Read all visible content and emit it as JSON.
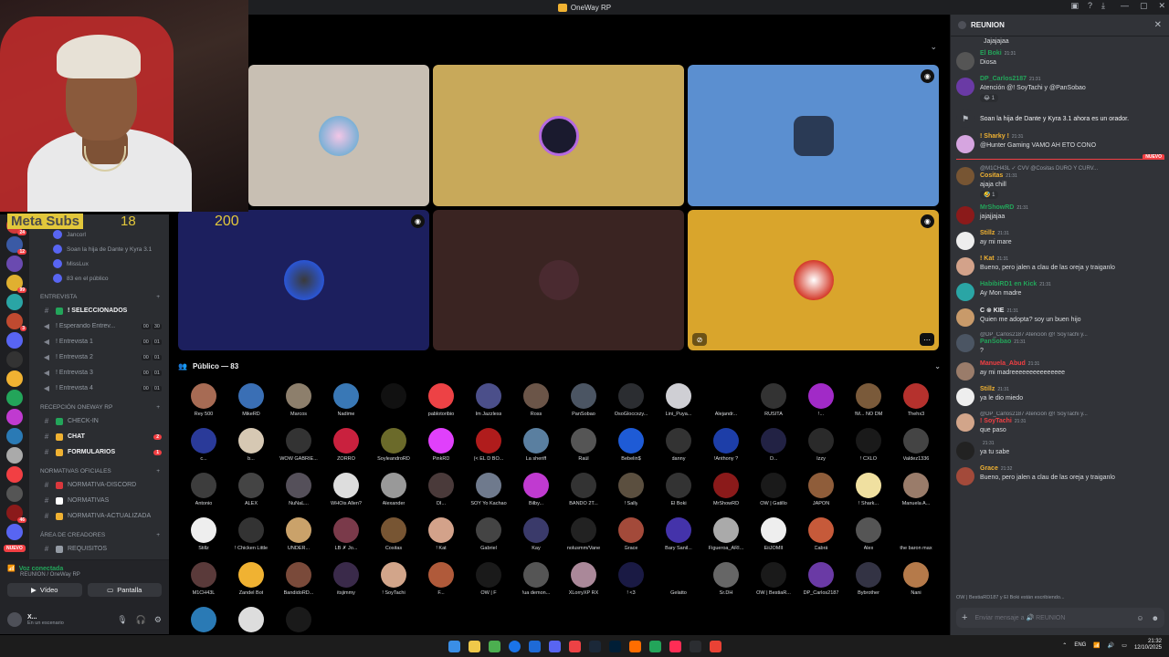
{
  "window": {
    "title": "OneWay RP"
  },
  "overlay": {
    "meta_label": "Meta Subs",
    "subs_count": "18",
    "goal": "200"
  },
  "voice_users": [
    {
      "name": "Jancorl"
    },
    {
      "name": "Soan la hija de Dante y Kyra 3.1"
    },
    {
      "name": "MissLux"
    },
    {
      "name": "83 en el público"
    }
  ],
  "sections": [
    {
      "type": "cat",
      "label": "ENTREVISTA"
    },
    {
      "type": "chan",
      "sym": "#",
      "label": "! SELECCIONADOS",
      "bold": true,
      "box": "#23a55a"
    },
    {
      "type": "chan",
      "sym": "🔊",
      "label": "! Esperando Entrev...",
      "counts": [
        "00",
        "30"
      ]
    },
    {
      "type": "chan",
      "sym": "🔊",
      "label": "! Entrevista 1",
      "counts": [
        "00",
        "01"
      ]
    },
    {
      "type": "chan",
      "sym": "🔊",
      "label": "! Entrevista 2",
      "counts": [
        "00",
        "01"
      ]
    },
    {
      "type": "chan",
      "sym": "🔊",
      "label": "! Entrevista 3",
      "counts": [
        "00",
        "01"
      ]
    },
    {
      "type": "chan",
      "sym": "🔊",
      "label": "! Entrevista 4",
      "counts": [
        "00",
        "01"
      ]
    },
    {
      "type": "cat",
      "label": "Recepción OneWay RP"
    },
    {
      "type": "chan",
      "sym": "#",
      "label": "CHECK-IN",
      "box": "#23a55a"
    },
    {
      "type": "chan",
      "sym": "#",
      "label": "CHAT",
      "bold": true,
      "box": "#f0b232",
      "badge": "2"
    },
    {
      "type": "chan",
      "sym": "#",
      "label": "FORMULARIOS",
      "bold": true,
      "box": "#f0b232",
      "badge": "1"
    },
    {
      "type": "cat",
      "label": "Normativas Oficiales"
    },
    {
      "type": "chan",
      "sym": "#",
      "label": "NORMATIVA-DISCORD",
      "box": "#da373c"
    },
    {
      "type": "chan",
      "sym": "#",
      "label": "NORMATIVAS",
      "box": "#ffffff"
    },
    {
      "type": "chan",
      "sym": "#",
      "label": "NORMATIVA-ACTUALIZADA",
      "box": "#f0b232"
    },
    {
      "type": "cat",
      "label": "Área de creadores"
    },
    {
      "type": "chan",
      "sym": "#",
      "label": "REQUISITOS",
      "box": "#949ba4"
    }
  ],
  "rail": {
    "nuevo": "NUEVO",
    "badges": [
      "24",
      "12",
      "",
      "99",
      "",
      "3",
      "",
      "",
      "",
      "",
      "",
      "",
      "",
      "",
      "",
      "46",
      ""
    ]
  },
  "voice_panel": {
    "status": "Voz conectada",
    "location": "REUNION / OneWay RP",
    "video": "Vídeo",
    "screen": "Pantalla"
  },
  "user_panel": {
    "name": "X...",
    "status": "En un escenario"
  },
  "stage": {
    "publico": "Público — 83"
  },
  "audience": [
    {
      "name": "Rey 500",
      "color": "#a76b54"
    },
    {
      "name": "MikeRD",
      "color": "#3a6fb5"
    },
    {
      "name": "Marcos",
      "color": "#8d7f6c"
    },
    {
      "name": "Nadime",
      "color": "#3978b6"
    },
    {
      "name": "",
      "color": "#111111"
    },
    {
      "name": "pablotoribio",
      "color": "#ed4245"
    },
    {
      "name": "Im Jazzless",
      "color": "#4b4f8a"
    },
    {
      "name": "Ross",
      "color": "#6b5548"
    },
    {
      "name": "PanSobao",
      "color": "#4b5563"
    },
    {
      "name": "OsoGloccxzy...",
      "color": "#2b2d31"
    },
    {
      "name": "Lini_Puya...",
      "color": "#cfcfd4"
    },
    {
      "name": "Alejandr...",
      "color": "#000000"
    },
    {
      "name": "RUSITA",
      "color": "#333333"
    },
    {
      "name": "!...",
      "color": "#a12ac7"
    },
    {
      "name": "!M... NO DM",
      "color": "#7a5a3a"
    },
    {
      "name": "Thehx3",
      "color": "#b5312d"
    },
    {
      "name": "c...",
      "color": "#2a3a99"
    },
    {
      "name": "b...",
      "color": "#d6c8b3"
    },
    {
      "name": "WOW GABRIE...",
      "color": "#333333"
    },
    {
      "name": "ZORRO",
      "color": "#c9213e"
    },
    {
      "name": "SoyleandroRD",
      "color": "#6b6a2a"
    },
    {
      "name": "PinkRD",
      "color": "#e040fb"
    },
    {
      "name": "(< EL D BO...",
      "color": "#b01c1c"
    },
    {
      "name": "La sheriff",
      "color": "#5a7fa0"
    },
    {
      "name": "Raúl",
      "color": "#555555"
    },
    {
      "name": "Bebelin$",
      "color": "#1e5bd6"
    },
    {
      "name": "danny",
      "color": "#333333"
    },
    {
      "name": "!Anthony ?",
      "color": "#1d3ea8"
    },
    {
      "name": "O...",
      "color": "#222244"
    },
    {
      "name": "Izzy",
      "color": "#2a2a2a"
    },
    {
      "name": "! CXLO",
      "color": "#1a1a1a"
    },
    {
      "name": "Valdez1336",
      "color": "#444444"
    },
    {
      "name": "Antonio",
      "color": "#3d3d3d"
    },
    {
      "name": "ALEX",
      "color": "#444444"
    },
    {
      "name": "NuNaL...",
      "color": "#55505a"
    },
    {
      "name": "WHOis Allen?",
      "color": "#dddddd"
    },
    {
      "name": "Alexander",
      "color": "#999999"
    },
    {
      "name": "DI...",
      "color": "#4a3a3a"
    },
    {
      "name": "SOY Yo Kachao",
      "color": "#6f7a8d"
    },
    {
      "name": "Bilby...",
      "color": "#c03ad0"
    },
    {
      "name": "BANDO 2T...",
      "color": "#333333"
    },
    {
      "name": "! Sally",
      "color": "#5b4f3f"
    },
    {
      "name": "El Boki",
      "color": "#333333"
    },
    {
      "name": "MrShowRD",
      "color": "#8b1a1a"
    },
    {
      "name": "OW | Gatillo",
      "color": "#1a1a1a"
    },
    {
      "name": "JAPON",
      "color": "#8f5d3a"
    },
    {
      "name": "! Shark...",
      "color": "#f0e0a0"
    },
    {
      "name": "Manuela A...",
      "color": "#9a7c6a"
    },
    {
      "name": "Stillz",
      "color": "#eeeeee"
    },
    {
      "name": "! Chicken Little",
      "color": "#333333"
    },
    {
      "name": "UNDER...",
      "color": "#caa26a"
    },
    {
      "name": "LB ✗ Jo...",
      "color": "#7a3a4a"
    },
    {
      "name": "Cositas",
      "color": "#775533"
    },
    {
      "name": "! Kat",
      "color": "#d3a28a"
    },
    {
      "name": "Gabriel",
      "color": "#444444"
    },
    {
      "name": "Kay",
      "color": "#3a3a6a"
    },
    {
      "name": "nolusmm/Vane",
      "color": "#222222"
    },
    {
      "name": "Grace",
      "color": "#a34a3a"
    },
    {
      "name": "Bary Sanil...",
      "color": "#4433aa"
    },
    {
      "name": "Figueroa_ARI...",
      "color": "#aaaaaa"
    },
    {
      "name": "EiiJOMII",
      "color": "#eeeeee"
    },
    {
      "name": "Cabrá",
      "color": "#c65a3a"
    },
    {
      "name": "Alex",
      "color": "#555555"
    },
    {
      "name": "the baron max",
      "color": "#000000"
    },
    {
      "name": "M1CH43L",
      "color": "#5a3a3a"
    },
    {
      "name": "Zandel Bot",
      "color": "#f0b232"
    },
    {
      "name": "BandidoRD...",
      "color": "#7a4a3a"
    },
    {
      "name": "itsjimmy",
      "color": "#3a2a4a"
    },
    {
      "name": "! SoyTachi",
      "color": "#d2a58a"
    },
    {
      "name": "F...",
      "color": "#b05a3a"
    },
    {
      "name": "OW | F",
      "color": "#1a1a1a"
    },
    {
      "name": "!ua demon...",
      "color": "#555555"
    },
    {
      "name": "XLorryXP RX",
      "color": "#aa8899"
    },
    {
      "name": "! <3",
      "color": "#1a1a44"
    },
    {
      "name": "Gelatto",
      "color": "#000000"
    },
    {
      "name": "Sr.DH",
      "color": "#666666"
    },
    {
      "name": "OW | BestiaR...",
      "color": "#1a1a1a"
    },
    {
      "name": "DP_Carlos2187",
      "color": "#6a3aa5"
    },
    {
      "name": "Bybrother",
      "color": "#333344"
    },
    {
      "name": "Nani",
      "color": "#b57a4a"
    },
    {
      "name": "",
      "color": "#2a7ab5"
    },
    {
      "name": "",
      "color": "#dddddd"
    },
    {
      "name": "",
      "color": "#1a1a1a"
    }
  ],
  "chat": {
    "channel": "REUNION",
    "input_placeholder": "Enviar mensaje a 🔊 REUNION",
    "typing": "OW | BestiaRD187 y El Boki están escribiendo...",
    "top_snippet": "Jajajajaa",
    "new_label": "NUEVO",
    "messages": [
      {
        "author": "El Boki",
        "color": "#23a55a",
        "time": "21:31",
        "text": "Diosa",
        "av": "#555555"
      },
      {
        "author": "DP_Carlos2187",
        "color": "#23a55a",
        "time": "21:31",
        "text": "Atención @! SoyTachi y @PanSobao",
        "react": "😂 1",
        "av": "#6a3aa5"
      },
      {
        "system": true,
        "text": "Soan la hija de Dante y Kyra 3.1 ahora es un orador.",
        "av": "#313338"
      },
      {
        "author": "! Sharky !",
        "color": "#f0b232",
        "time": "21:31",
        "text": "@Hunter Gaming VAMO AH ETO CONO",
        "av": "#d6a5e0"
      },
      {
        "reply": "@M1CH43L ✓ CVV @Cositas DURO Y CURV...",
        "author": "Cositas",
        "color": "#f0b232",
        "time": "21:31",
        "text": "ajaja chill",
        "react": "🤣 1",
        "av": "#775533",
        "nuevo": true
      },
      {
        "author": "MrShowRD",
        "color": "#23a55a",
        "time": "21:31",
        "text": "jajajjajaa",
        "av": "#8b1a1a"
      },
      {
        "author": "Stillz",
        "color": "#f0b232",
        "time": "21:31",
        "text": "ay mi mare",
        "av": "#eeeeee"
      },
      {
        "author": "! Kat",
        "color": "#f0b232",
        "time": "21:31",
        "text": "Bueno, pero jalen a clau de las oreja y traiganlo",
        "av": "#d3a28a"
      },
      {
        "author": "HabibiRD1 en Kick",
        "color": "#23a55a",
        "time": "21:31",
        "text": "Ay Mon madre",
        "av": "#2aa5a5"
      },
      {
        "author": "C ⊗ KIE",
        "color": "#f2f3f5",
        "time": "21:31",
        "text": "Quien me adopta? soy un buen hijo",
        "av": "#c89a6a"
      },
      {
        "reply": "@DP_Carlos2187 Atención @! SoyTachi y...",
        "author": "PanSobao",
        "color": "#23a55a",
        "time": "21:31",
        "text": "?",
        "av": "#4b5563"
      },
      {
        "author": "Manuela_Abud",
        "color": "#f23f43",
        "time": "21:31",
        "text": "ay mi madreeeeeeeeeeeeeee",
        "av": "#9a7c6a"
      },
      {
        "author": "Stillz",
        "color": "#f0b232",
        "time": "21:31",
        "text": "ya le dio miedo",
        "av": "#eeeeee"
      },
      {
        "reply": "@DP_Carlos2187 Atención @! SoyTachi y...",
        "author": "! SoyTachi",
        "color": "#f23f43",
        "time": "21:31",
        "text": "que paso",
        "av": "#d2a58a"
      },
      {
        "author": "",
        "color": "#f2f3f5",
        "time": "21:31",
        "text": "ya tu sabe",
        "av": "#222222"
      },
      {
        "author": "Grace",
        "color": "#f0b232",
        "time": "21:32",
        "text": "Bueno, pero jalen a clau de las oreja y traiganlo",
        "av": "#a34a3a"
      }
    ]
  },
  "taskbar": {
    "lang": "ENG",
    "time": "21:32",
    "date": "12/10/2025"
  }
}
